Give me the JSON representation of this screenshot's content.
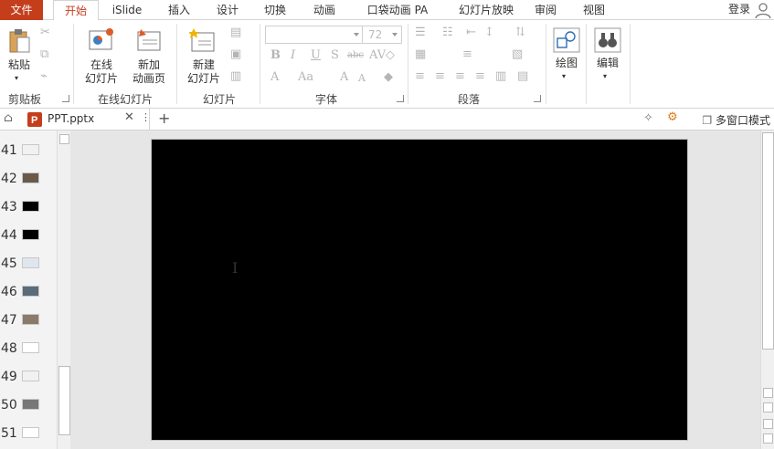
{
  "tabs": {
    "file": "文件",
    "home": "开始",
    "islide": "iSlide",
    "insert": "插入",
    "design": "设计",
    "transitions": "切换",
    "animations": "动画",
    "pocket_animation": "口袋动画 PA",
    "slideshow": "幻灯片放映",
    "review": "审阅",
    "view": "视图"
  },
  "login": "登录",
  "ribbon": {
    "clipboard": {
      "paste": "粘贴",
      "group": "剪贴板"
    },
    "online_slides": {
      "online_slide": "在线\n幻灯片",
      "new_anim_page": "新加\n动画页",
      "group": "在线幻灯片"
    },
    "slides": {
      "new_slide": "新建\n幻灯片",
      "group": "幻灯片"
    },
    "font": {
      "font_name": "",
      "font_size": "72",
      "group": "字体"
    },
    "paragraph": {
      "group": "段落"
    },
    "drawing": {
      "label": "绘图"
    },
    "editing": {
      "label": "编辑"
    }
  },
  "docbar": {
    "filename": "PPT.pptx",
    "multi_window": "多窗口模式"
  },
  "thumbnails": [
    {
      "num": "41"
    },
    {
      "num": "42"
    },
    {
      "num": "43"
    },
    {
      "num": "44"
    },
    {
      "num": "45"
    },
    {
      "num": "46"
    },
    {
      "num": "47"
    },
    {
      "num": "48"
    },
    {
      "num": "49"
    },
    {
      "num": "50"
    },
    {
      "num": "51"
    }
  ],
  "colors": {
    "accent": "#c43e1c",
    "slide_bg": "#000000"
  }
}
